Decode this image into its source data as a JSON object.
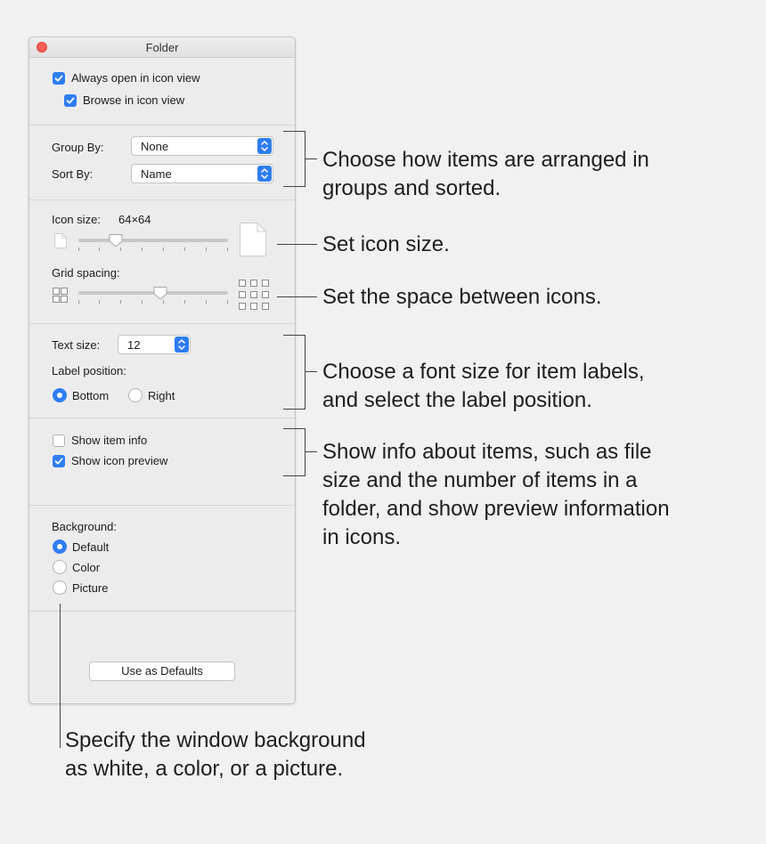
{
  "window": {
    "title": "Folder",
    "always_open_label": "Always open in icon view",
    "browse_label": "Browse in icon view",
    "group_by_label": "Group By:",
    "group_by_value": "None",
    "sort_by_label": "Sort By:",
    "sort_by_value": "Name",
    "icon_size_label": "Icon size:",
    "icon_size_value": "64×64",
    "grid_spacing_label": "Grid spacing:",
    "text_size_label": "Text size:",
    "text_size_value": "12",
    "label_position_label": "Label position:",
    "label_bottom": "Bottom",
    "label_right": "Right",
    "show_item_info": "Show item info",
    "show_icon_preview": "Show icon preview",
    "background_label": "Background:",
    "bg_default": "Default",
    "bg_color": "Color",
    "bg_picture": "Picture",
    "use_defaults": "Use as Defaults"
  },
  "state": {
    "always_open_checked": true,
    "browse_checked": true,
    "show_item_info_checked": false,
    "show_icon_preview_checked": true,
    "label_position": "Bottom",
    "background": "Default",
    "icon_size_slider_fraction": 0.25,
    "grid_spacing_slider_fraction": 0.55
  },
  "annotations": {
    "arrange": [
      "Choose how items are arranged in",
      "groups and sorted."
    ],
    "icon_size": [
      "Set icon size."
    ],
    "spacing": [
      "Set the space between icons."
    ],
    "font": [
      "Choose a font size for item labels,",
      "and select the label position."
    ],
    "info": [
      "Show info about items, such as file",
      "size and the number of items in a",
      "folder, and show preview information",
      "in icons."
    ],
    "background": [
      "Specify the window background",
      "as white, a color, or a picture."
    ]
  },
  "colors": {
    "accent": "#2f7df6",
    "close": "#ff5f57",
    "window_bg": "#ececec"
  }
}
